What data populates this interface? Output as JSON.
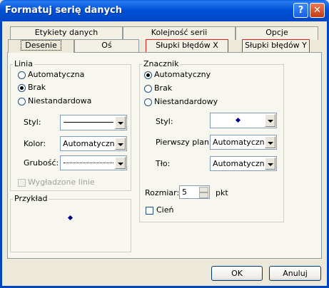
{
  "window": {
    "title": "Formatuj serię danych",
    "help_glyph": "?",
    "close_glyph": "✕"
  },
  "tabs": {
    "row1": [
      "Etykiety danych",
      "Kolejność serii",
      "Opcje"
    ],
    "row2": [
      "Desenie",
      "Oś",
      "Słupki błędów X",
      "Słupki błędów Y"
    ],
    "active": "Desenie"
  },
  "line": {
    "title": "Linia",
    "options": [
      "Automatyczna",
      "Brak",
      "Niestandardowa"
    ],
    "selected": "Brak",
    "style_label": "Styl:",
    "color_label": "Kolor:",
    "color_value": "Automatyczny",
    "weight_label": "Grubość:",
    "smoothed_label": "Wygładzone linie"
  },
  "example": {
    "title": "Przykład"
  },
  "marker": {
    "title": "Znacznik",
    "options": [
      "Automatyczny",
      "Brak",
      "Niestandardowy"
    ],
    "selected": "Automatyczny",
    "style_label": "Styl:",
    "foreground_label": "Pierwszy plan:",
    "foreground_value": "Automatyczny",
    "background_label": "Tło:",
    "background_value": "Automatyczny",
    "size_label": "Rozmiar:",
    "size_value": "5",
    "size_unit": "pkt",
    "shadow_label": "Cień",
    "marker_color": "#00008b"
  },
  "buttons": {
    "ok": "OK",
    "cancel": "Anuluj"
  },
  "colors": {
    "title_blue": "#0052d8",
    "tab_highlight_red": "#e12020",
    "face": "#ece9d8"
  }
}
